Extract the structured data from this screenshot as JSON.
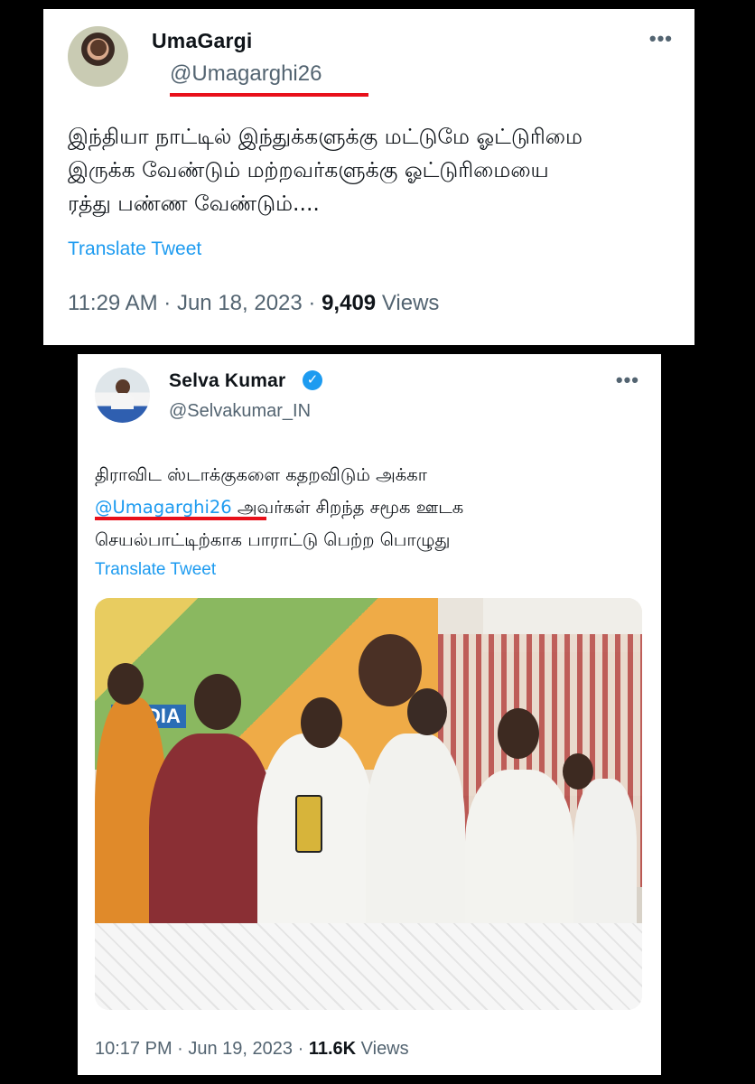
{
  "tweet1": {
    "display_name": "UmaGargi",
    "handle": "@Umagarghi26",
    "more_icon": "more-horizontal-icon",
    "text_lines": [
      "இந்தியா நாட்டில் இந்துக்களுக்கு மட்டுமே ஓட்டுரிமை",
      "இருக்க வேண்டும் மற்றவர்களுக்கு ஓட்டுரிமையை",
      "ரத்து பண்ண வேண்டும்...."
    ],
    "translate_label": "Translate Tweet",
    "time": "11:29 AM · Jun 18, 2023 ·",
    "views_count": "9,409",
    "views_label": "Views"
  },
  "tweet2": {
    "display_name": "Selva Kumar",
    "verified_icon": "verified-badge-icon",
    "handle": "@Selvakumar_IN",
    "more_icon": "more-horizontal-icon",
    "text_line1": "திராவிட ஸ்டாக்குகளை கதறவிடும் அக்கா",
    "mention": "@Umagarghi26",
    "text_line2_rest": " அவர்கள் சிறந்த சமூக ஊடக",
    "text_line3": "செயல்பாட்டிற்காக பாராட்டு பெற்ற பொழுது",
    "translate_label": "Translate Tweet",
    "photo_banner_text": "MEDIA",
    "time": "10:17 PM · Jun 19, 2023 ·",
    "views_count": "11.6K",
    "views_label": "Views"
  },
  "colors": {
    "link": "#1d9bf0",
    "annotation_underline": "#e8101a",
    "background": "#000000"
  }
}
